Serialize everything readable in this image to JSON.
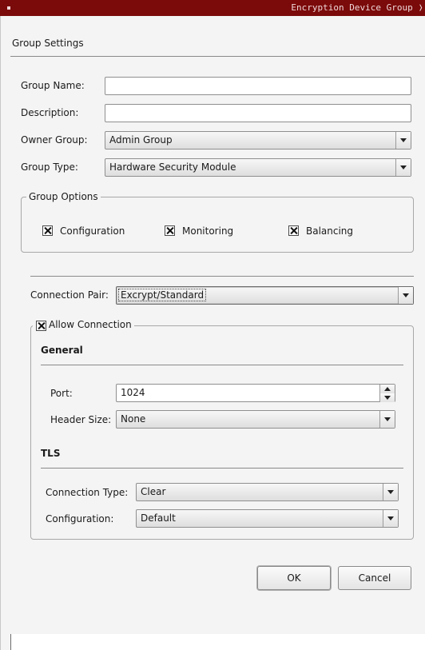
{
  "window": {
    "title": "Encryption Device Group ❭"
  },
  "header": {
    "section_title": "Group Settings"
  },
  "group": {
    "name_label": "Group Name:",
    "name_value": "",
    "description_label": "Description:",
    "description_value": "",
    "owner_label": "Owner Group:",
    "owner_value": "Admin Group",
    "type_label": "Group Type:",
    "type_value": "Hardware Security Module"
  },
  "options": {
    "legend": "Group Options",
    "items": [
      {
        "label": "Configuration",
        "checked": true
      },
      {
        "label": "Monitoring",
        "checked": true
      },
      {
        "label": "Balancing",
        "checked": true
      }
    ]
  },
  "connection": {
    "pair_label": "Connection Pair:",
    "pair_value": "Excrypt/Standard",
    "allow_label": "Allow Connection",
    "allow_checked": true,
    "general_heading": "General",
    "port_label": "Port:",
    "port_value": "1024",
    "header_size_label": "Header Size:",
    "header_size_value": "None",
    "tls_heading": "TLS",
    "conn_type_label": "Connection Type:",
    "conn_type_value": "Clear",
    "config_label": "Configuration:",
    "config_value": "Default"
  },
  "buttons": {
    "ok": "OK",
    "cancel": "Cancel"
  }
}
